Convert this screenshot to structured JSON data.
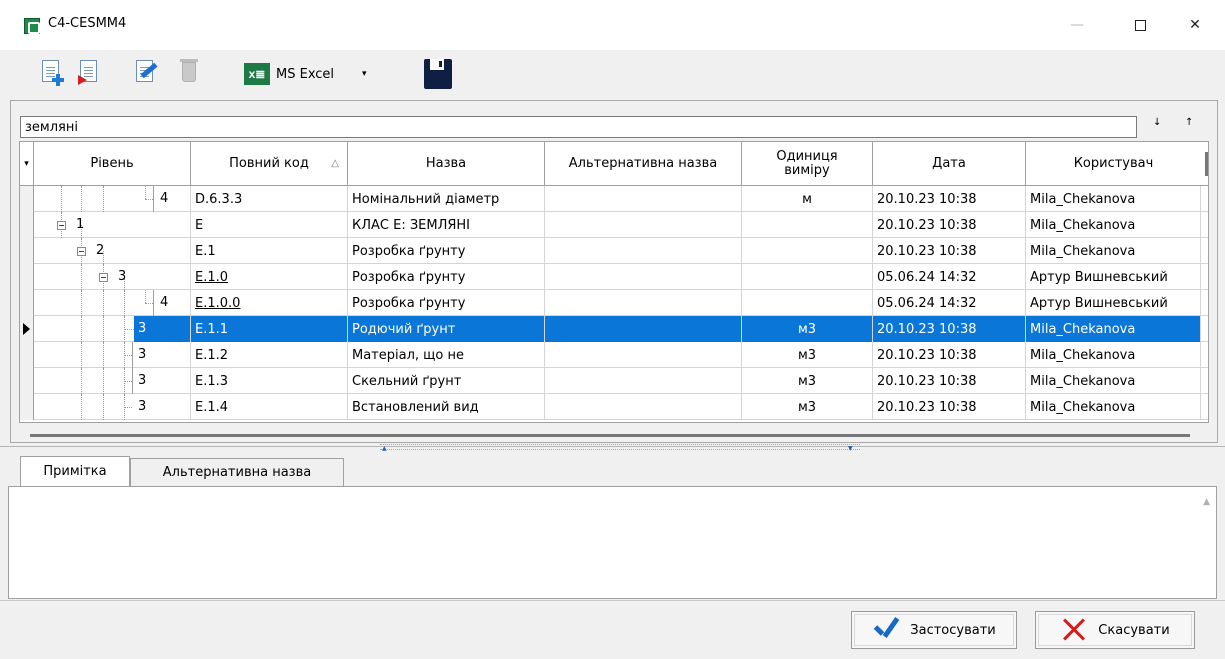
{
  "window": {
    "title": "C4-CESMM4",
    "minimize_glyph": "—",
    "close_glyph": "✕"
  },
  "toolbar": {
    "excel_logo": "x≣",
    "excel_label": "MS Excel",
    "dropdown_glyph": "▾"
  },
  "filter": {
    "value": "земляні",
    "down_glyph": "↓",
    "up_glyph": "↑"
  },
  "grid": {
    "columns": [
      {
        "label": "Рівень"
      },
      {
        "label": "Повний код",
        "sort": "△"
      },
      {
        "label": "Назва"
      },
      {
        "label": "Альтернативна назва"
      },
      {
        "label": "Одиниця виміру"
      },
      {
        "label": "Дата"
      },
      {
        "label": "Користувач"
      }
    ],
    "filter_glyph": "▾",
    "rows": [
      {
        "level": "4",
        "code": "D.6.3.3",
        "name": "Номінальний діаметр",
        "alt": "",
        "unit": "м",
        "date": "20.10.23 10:38",
        "user": "Mila_Chekanova"
      },
      {
        "level": "1",
        "code": "E",
        "name": "КЛАС Е: ЗЕМЛЯНІ",
        "alt": "",
        "unit": "",
        "date": "20.10.23 10:38",
        "user": "Mila_Chekanova"
      },
      {
        "level": "2",
        "code": "E.1",
        "name": "Розробка ґрунту",
        "alt": "",
        "unit": "",
        "date": "20.10.23 10:38",
        "user": "Mila_Chekanova"
      },
      {
        "level": "3",
        "code": "E.1.0",
        "name": "Розробка ґрунту",
        "alt": "",
        "unit": "",
        "date": "05.06.24 14:32",
        "user": "Артур Вишневський"
      },
      {
        "level": "4",
        "code": "E.1.0.0",
        "name": "Розробка ґрунту",
        "alt": "",
        "unit": "",
        "date": "05.06.24 14:32",
        "user": "Артур Вишневський"
      },
      {
        "level": "3",
        "code": "E.1.1",
        "name": "Родючий ґрунт",
        "alt": "",
        "unit": "м3",
        "date": "20.10.23 10:38",
        "user": "Mila_Chekanova"
      },
      {
        "level": "3",
        "code": "E.1.2",
        "name": "Матеріал, що не",
        "alt": "",
        "unit": "м3",
        "date": "20.10.23 10:38",
        "user": "Mila_Chekanova"
      },
      {
        "level": "3",
        "code": "E.1.3",
        "name": "Скельний ґрунт",
        "alt": "",
        "unit": "м3",
        "date": "20.10.23 10:38",
        "user": "Mila_Chekanova"
      },
      {
        "level": "3",
        "code": "E.1.4",
        "name": "Встановлений вид",
        "alt": "",
        "unit": "м3",
        "date": "20.10.23 10:38",
        "user": "Mila_Chekanova"
      }
    ]
  },
  "splitter": {
    "up_glyph": "▲",
    "down_glyph": "▼"
  },
  "tabs": [
    {
      "label": "Примітка"
    },
    {
      "label": "Альтернативна назва"
    }
  ],
  "note": {
    "scroll_glyph": "▲"
  },
  "buttons": {
    "apply": "Застосувати",
    "cancel": "Скасувати"
  },
  "colors": {
    "selection": "#0a76d7",
    "excel_green": "#1d7a44",
    "apply_blue": "#1769c8",
    "cancel_red": "#d71a1a"
  }
}
